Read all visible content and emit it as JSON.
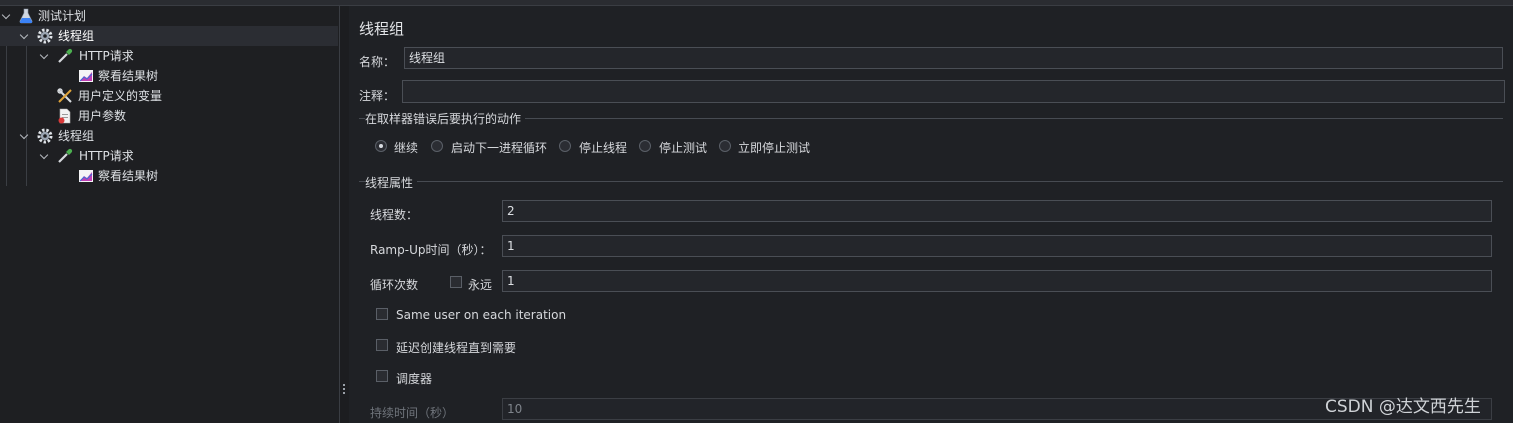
{
  "tree": {
    "items": [
      {
        "label": "测试计划"
      },
      {
        "label": "线程组"
      },
      {
        "label": "HTTP请求"
      },
      {
        "label": "察看结果树"
      },
      {
        "label": "用户定义的变量"
      },
      {
        "label": "用户参数"
      },
      {
        "label": "线程组"
      },
      {
        "label": "HTTP请求"
      },
      {
        "label": "察看结果树"
      }
    ]
  },
  "panel": {
    "title": "线程组",
    "name_label": "名称：",
    "name_value": "线程组",
    "comment_label": "注释：",
    "comment_value": "",
    "error_section": {
      "title": "在取样器错误后要执行的动作",
      "options": [
        "继续",
        "启动下一进程循环",
        "停止线程",
        "停止测试",
        "立即停止测试"
      ],
      "selected": "继续"
    },
    "thread_props": {
      "title": "线程属性",
      "threads_label": "线程数：",
      "threads_value": "2",
      "rampup_label": "Ramp-Up时间（秒）：",
      "rampup_value": "1",
      "loop_label": "循环次数",
      "forever_label": "永远",
      "loop_value": "1",
      "same_user_label": "Same user on each iteration",
      "delay_label": "延迟创建线程直到需要",
      "scheduler_label": "调度器",
      "duration_label": "持续时间（秒）",
      "duration_value": "10"
    }
  },
  "watermark": "CSDN @达文西先生",
  "colors": {
    "background": "#1e1f22",
    "panel": "#1f2125",
    "selected_row": "#2b2d33"
  }
}
